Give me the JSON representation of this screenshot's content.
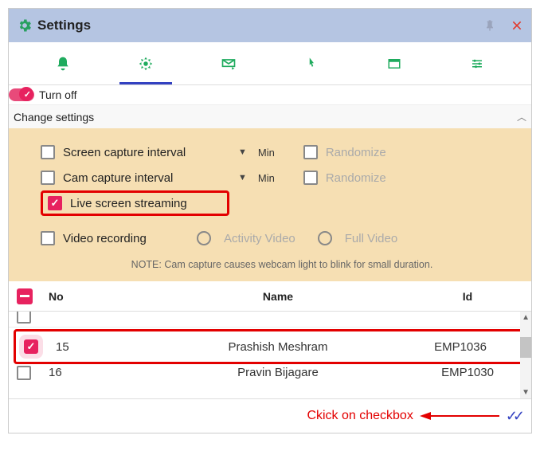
{
  "title": "Settings",
  "toggle": {
    "label": "Turn off"
  },
  "section": {
    "title": "Change settings"
  },
  "options": {
    "screen_capture": {
      "label": "Screen capture interval",
      "unit": "Min",
      "randomize": "Randomize"
    },
    "cam_capture": {
      "label": "Cam capture interval",
      "unit": "Min",
      "randomize": "Randomize"
    },
    "live_stream": {
      "label": "Live screen streaming"
    },
    "video_rec": {
      "label": "Video recording",
      "activity": "Activity Video",
      "full": "Full Video"
    },
    "note": "NOTE: Cam capture causes webcam light to blink for small duration."
  },
  "table": {
    "headers": {
      "no": "No",
      "name": "Name",
      "id": "Id"
    },
    "rows": [
      {
        "no": "15",
        "name": "Prashish Meshram",
        "id": "EMP1036",
        "checked": true
      }
    ],
    "partial_bottom": {
      "no": "16",
      "name": "Pravin Bijagare",
      "id": "EMP1030"
    }
  },
  "annotation": "Ckick on checkbox"
}
